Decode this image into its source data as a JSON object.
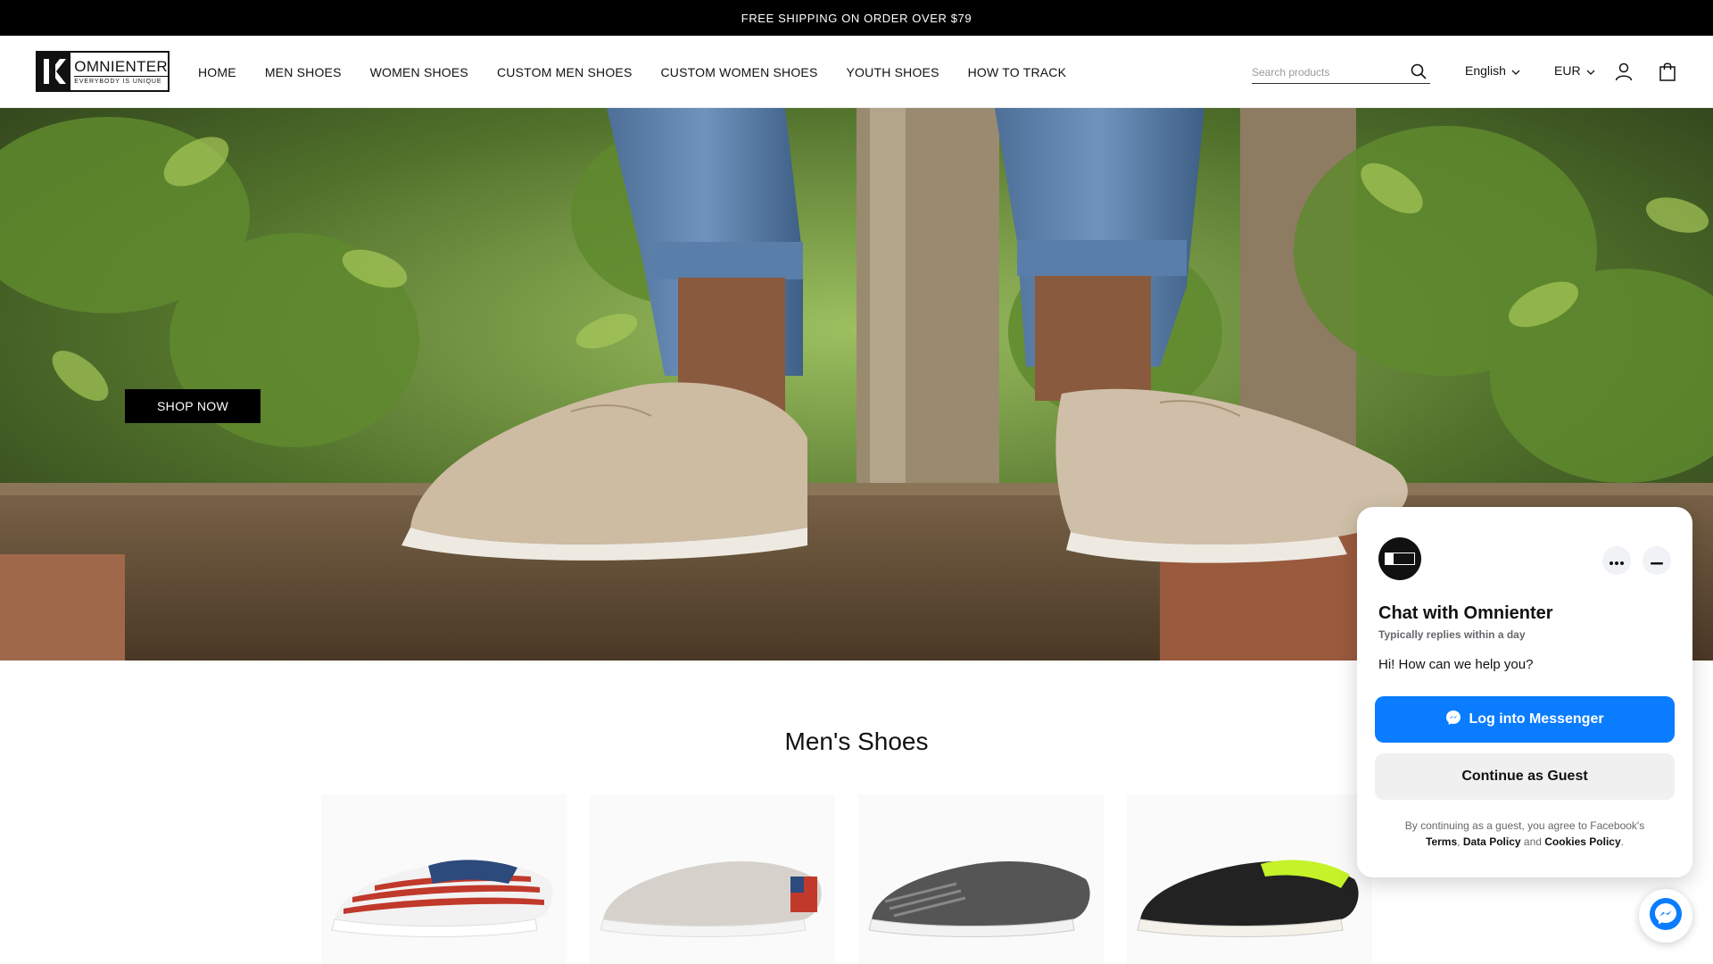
{
  "announcement": {
    "text": "FREE SHIPPING ON ORDER OVER $79"
  },
  "brand": {
    "name": "OMNIENTER",
    "tagline": "EVERYBODY IS UNIQUE"
  },
  "nav": {
    "items": [
      {
        "label": "HOME"
      },
      {
        "label": "MEN SHOES"
      },
      {
        "label": "WOMEN SHOES"
      },
      {
        "label": "CUSTOM MEN SHOES"
      },
      {
        "label": "CUSTOM WOMEN SHOES"
      },
      {
        "label": "YOUTH SHOES"
      },
      {
        "label": "HOW TO TRACK"
      }
    ]
  },
  "search": {
    "placeholder": "Search products",
    "value": "",
    "icon": "search-icon"
  },
  "language": {
    "value": "English",
    "icon": "chevron-down-icon"
  },
  "currency": {
    "value": "EUR",
    "icon": "chevron-down-icon"
  },
  "header_icons": {
    "account": "user-icon",
    "cart": "bag-icon"
  },
  "hero": {
    "cta_label": "SHOP NOW"
  },
  "section": {
    "title": "Men's Shoes"
  },
  "products": [
    {
      "style": "american-flag"
    },
    {
      "style": "light-grey-flag-heel"
    },
    {
      "style": "grey-stars"
    },
    {
      "style": "black-neon"
    }
  ],
  "chat": {
    "title": "Chat with Omnienter",
    "subtitle": "Typically replies within a day",
    "greeting": "Hi! How can we help you?",
    "messenger_button": "Log into Messenger",
    "guest_button": "Continue as Guest",
    "legal_prefix": "By continuing as a guest, you agree to Facebook's",
    "legal_terms": "Terms",
    "legal_comma": ",",
    "legal_data": "Data Policy",
    "legal_and": "and",
    "legal_cookies": "Cookies Policy",
    "legal_period": ".",
    "accent": "#0a7cff"
  }
}
